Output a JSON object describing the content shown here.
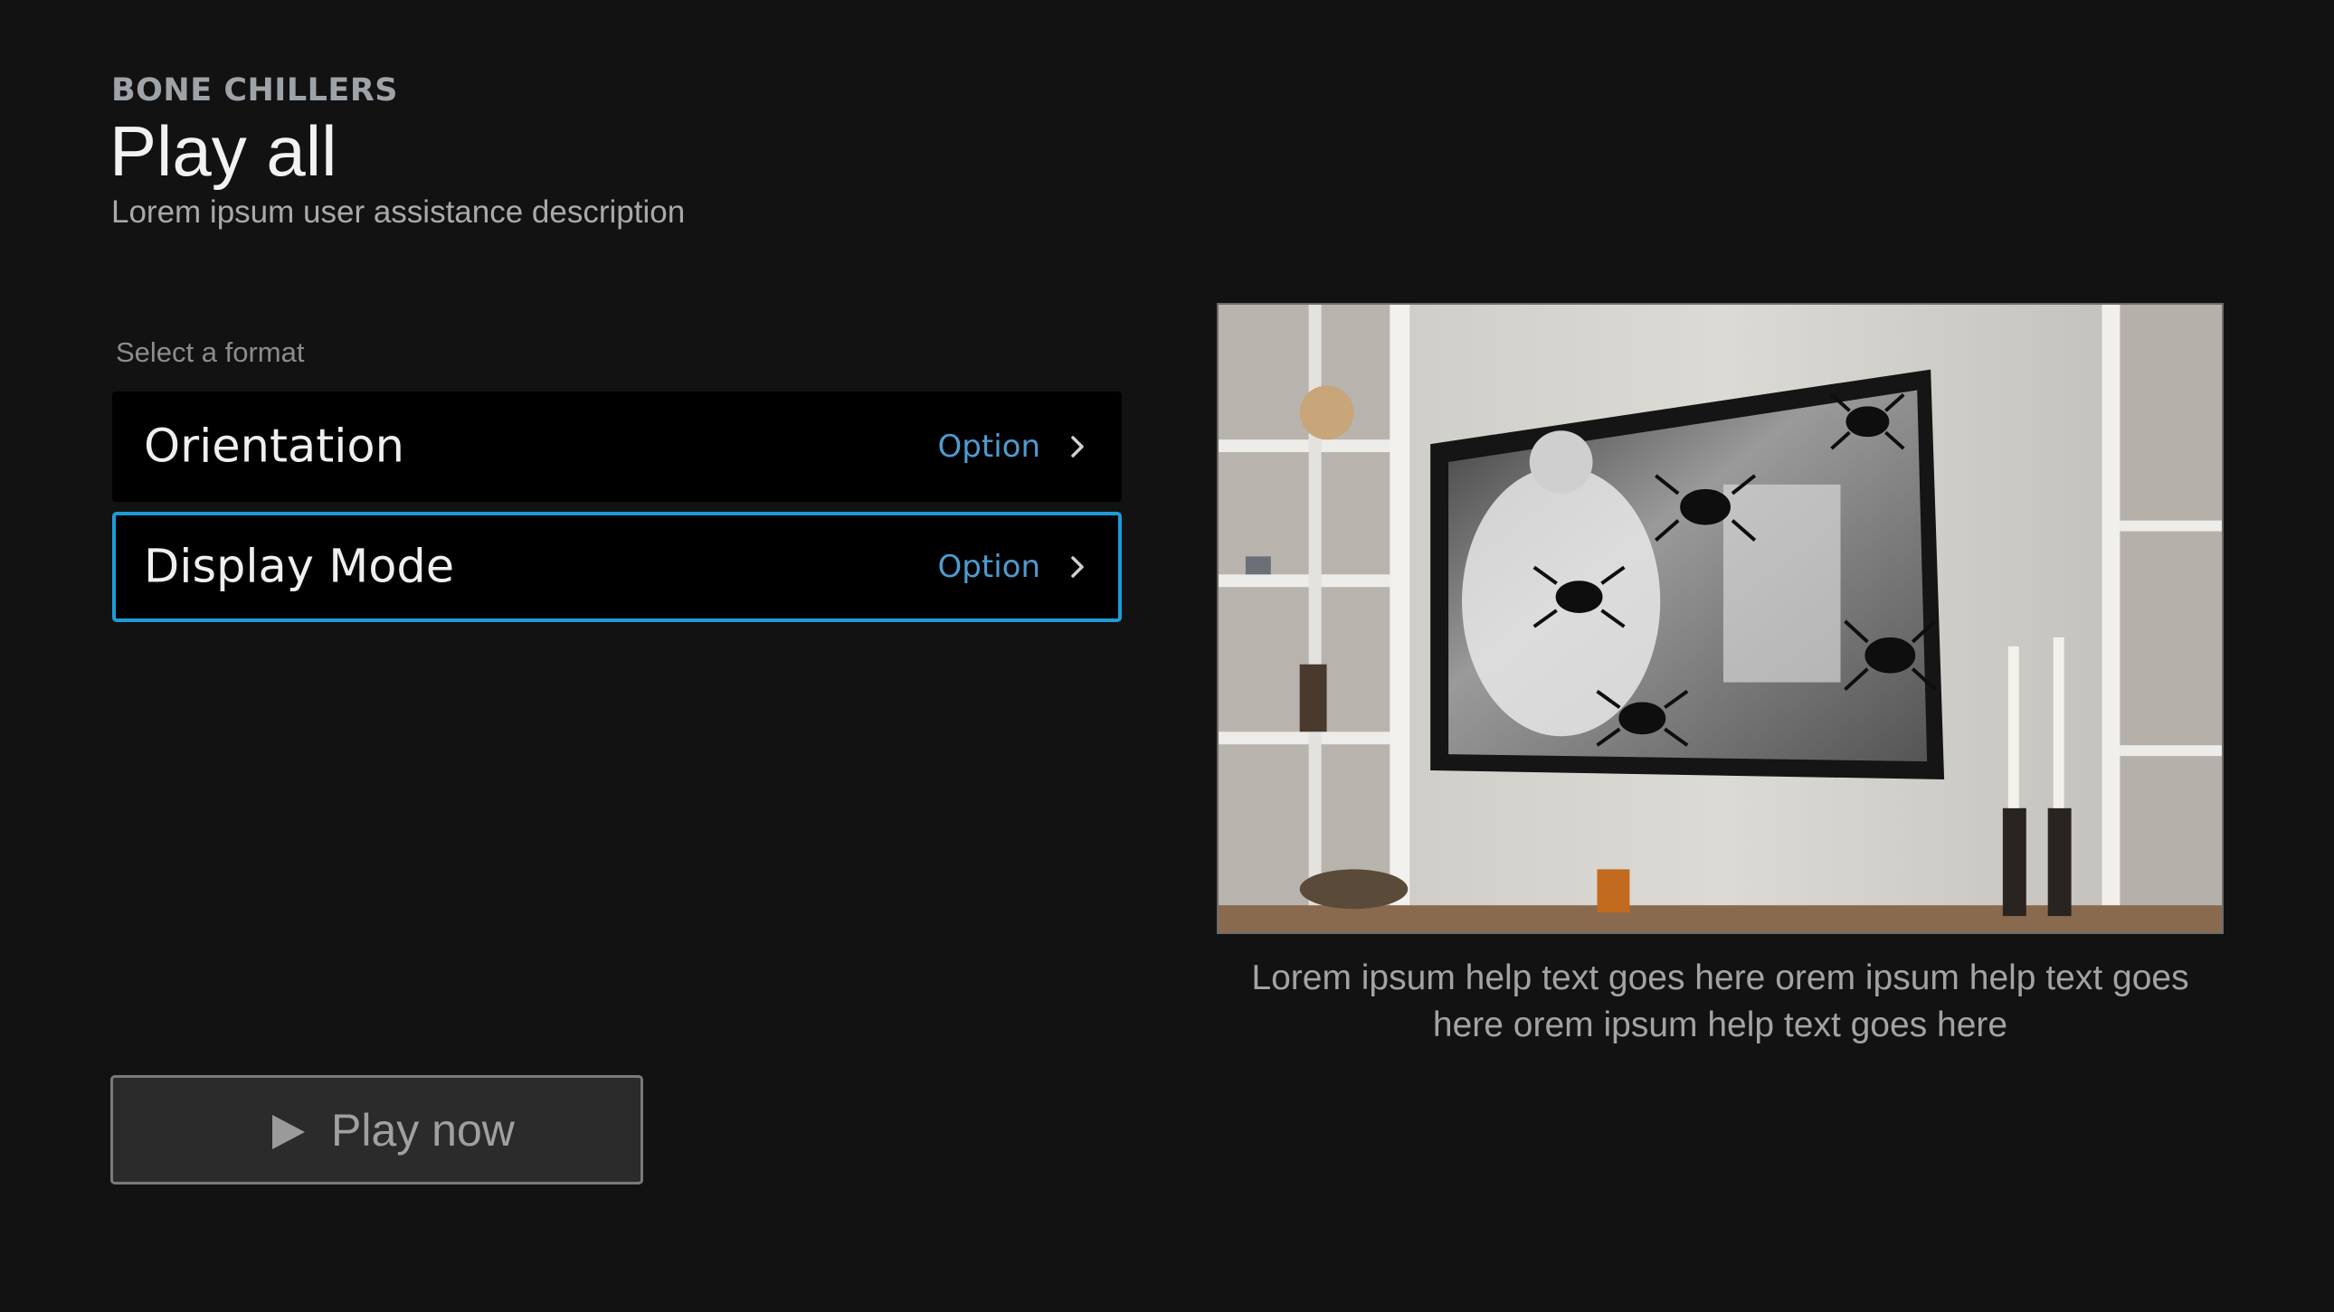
{
  "header": {
    "eyebrow": "BONE CHILLERS",
    "title": "Play all",
    "subtitle": "Lorem ipsum user assistance description"
  },
  "format": {
    "section_label": "Select a format",
    "rows": [
      {
        "label": "Orientation",
        "value": "Option",
        "focused": false
      },
      {
        "label": "Display Mode",
        "value": "Option",
        "focused": true
      }
    ]
  },
  "play_button": {
    "label": "Play now",
    "icon": "play-icon"
  },
  "preview": {
    "image": "living room wall with tv showing black and white movie scene with spiders",
    "help_text": "Lorem ipsum help text goes here orem ipsum help text goes here orem ipsum help text goes here"
  },
  "colors": {
    "background": "#121212",
    "accent_focus": "#1e9bd7",
    "option_value": "#4e9bd0"
  }
}
